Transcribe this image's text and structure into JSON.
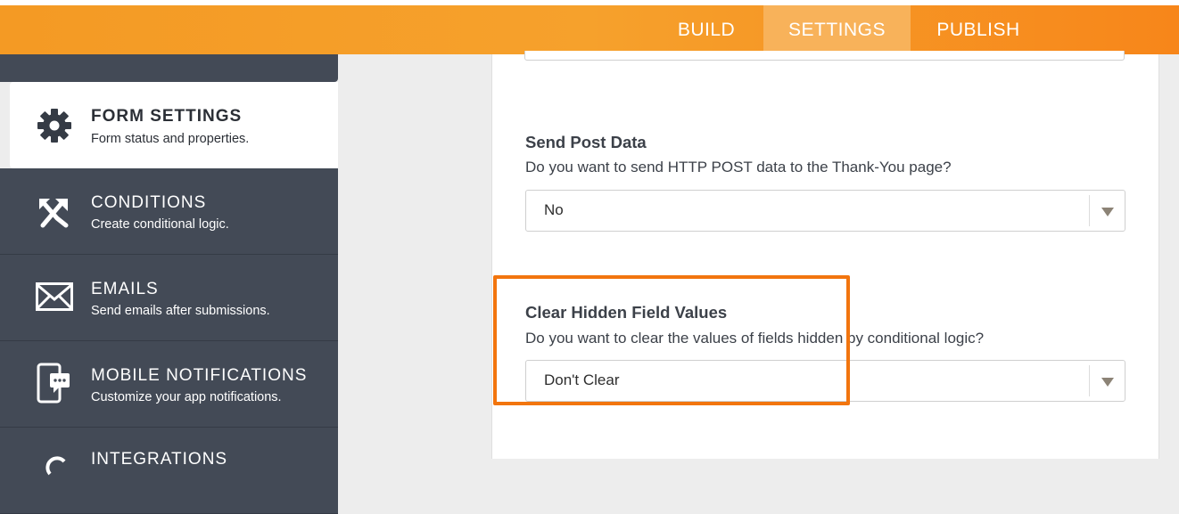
{
  "topnav": {
    "tabs": [
      {
        "label": "BUILD",
        "active": false
      },
      {
        "label": "SETTINGS",
        "active": true
      },
      {
        "label": "PUBLISH",
        "active": false
      }
    ]
  },
  "sidebar": {
    "items": [
      {
        "title": "FORM SETTINGS",
        "subtitle": "Form status and properties.",
        "icon": "gear-icon",
        "active": true
      },
      {
        "title": "CONDITIONS",
        "subtitle": "Create conditional logic.",
        "icon": "conditions-arrows-icon",
        "active": false
      },
      {
        "title": "EMAILS",
        "subtitle": "Send emails after submissions.",
        "icon": "envelope-icon",
        "active": false
      },
      {
        "title": "MOBILE NOTIFICATIONS",
        "subtitle": "Customize your app notifications.",
        "icon": "mobile-chat-icon",
        "active": false
      },
      {
        "title": "INTEGRATIONS",
        "subtitle": "",
        "icon": "integrations-icon",
        "active": false
      }
    ]
  },
  "settings": {
    "send_post_data": {
      "title": "Send Post Data",
      "description": "Do you want to send HTTP POST data to the Thank-You page?",
      "value": "No"
    },
    "clear_hidden": {
      "title": "Clear Hidden Field Values",
      "description": "Do you want to clear the values of fields hidden by conditional logic?",
      "value": "Don't Clear"
    }
  },
  "colors": {
    "accent": "#f49a24",
    "active_tab": "#f8b25a",
    "sidebar_bg": "#434a56",
    "highlight": "#f2750e"
  }
}
